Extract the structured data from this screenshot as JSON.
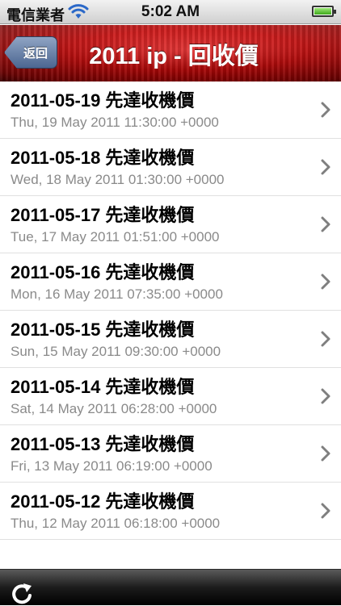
{
  "status_bar": {
    "carrier": "電信業者",
    "time": "5:02 AM",
    "wifi_icon": "wifi-icon",
    "battery_icon": "battery-icon"
  },
  "nav_bar": {
    "back_label": "返回",
    "title": "2011 ip - 回收價"
  },
  "list": {
    "items": [
      {
        "title": "2011-05-19 先達收機價",
        "subtitle": "Thu, 19 May 2011 11:30:00 +0000"
      },
      {
        "title": "2011-05-18 先達收機價",
        "subtitle": "Wed, 18 May 2011 01:30:00 +0000"
      },
      {
        "title": "2011-05-17 先達收機價",
        "subtitle": "Tue, 17 May 2011 01:51:00 +0000"
      },
      {
        "title": "2011-05-16 先達收機價",
        "subtitle": "Mon, 16 May 2011 07:35:00 +0000"
      },
      {
        "title": "2011-05-15 先達收機價",
        "subtitle": "Sun, 15 May 2011 09:30:00 +0000"
      },
      {
        "title": "2011-05-14 先達收機價",
        "subtitle": "Sat, 14 May 2011 06:28:00 +0000"
      },
      {
        "title": "2011-05-13 先達收機價",
        "subtitle": "Fri, 13 May 2011 06:19:00 +0000"
      },
      {
        "title": "2011-05-12 先達收機價",
        "subtitle": "Thu, 12 May 2011 06:18:00 +0000"
      }
    ]
  },
  "toolbar": {
    "refresh_icon": "refresh-icon"
  },
  "colors": {
    "nav_red": "#d10000",
    "back_button_blue": "#4c6691",
    "subtitle_gray": "#8a8a8a",
    "chevron_gray": "#7f7f7f"
  }
}
